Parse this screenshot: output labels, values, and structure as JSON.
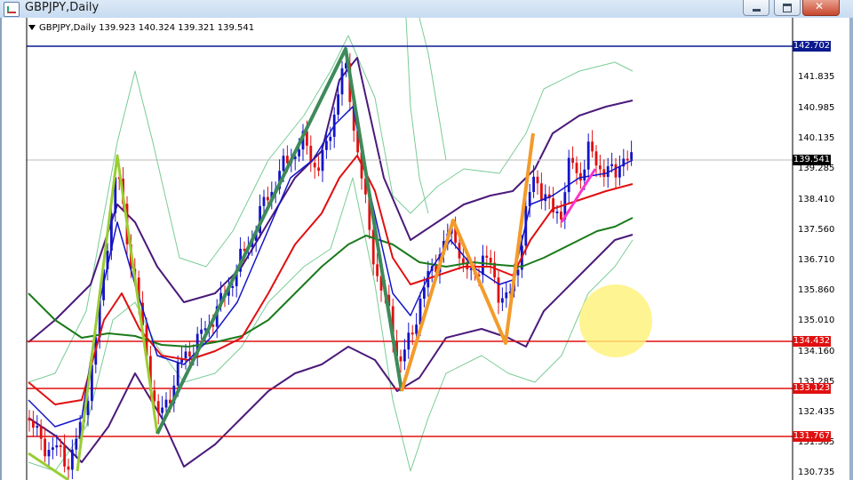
{
  "window": {
    "title": "GBPJPY,Daily"
  },
  "chart": {
    "header_symbol": "GBPJPY,Daily",
    "header_ohlc": "139.923 140.324 139.321 139.541",
    "price_ticks": [
      "141.835",
      "140.985",
      "140.135",
      "139.285",
      "138.410",
      "137.560",
      "136.710",
      "135.860",
      "135.010",
      "134.160",
      "133.285",
      "132.435",
      "131.585",
      "130.735"
    ],
    "markers": [
      {
        "label": "142.702",
        "color": "#0b1a8e"
      },
      {
        "label": "139.541",
        "color": "#000000"
      },
      {
        "label": "134.432",
        "color": "#e01010"
      },
      {
        "label": "133.123",
        "color": "#e01010"
      },
      {
        "label": "131.767",
        "color": "#e01010"
      }
    ],
    "colors": {
      "bull_candle": "#1414c8",
      "bear_candle": "#e01010",
      "ma_fast": "#1414c8",
      "ma_mid": "#e01010",
      "ma_slow": "#1a7a1a",
      "envelope": "#4b1a7a",
      "bands": "#7acc96",
      "resistance": "#0b1a8e",
      "support": "#e01010",
      "wave_green": "#3e8a5a",
      "wave_lime": "#9acd32",
      "wave_orange": "#f39b2a",
      "wave_magenta": "#ff33cc",
      "highlight_circle": "#fff27a"
    },
    "icons": [
      "chart-app-icon",
      "minimize-icon",
      "maximize-icon",
      "close-icon",
      "dropdown-triangle-icon"
    ]
  }
}
